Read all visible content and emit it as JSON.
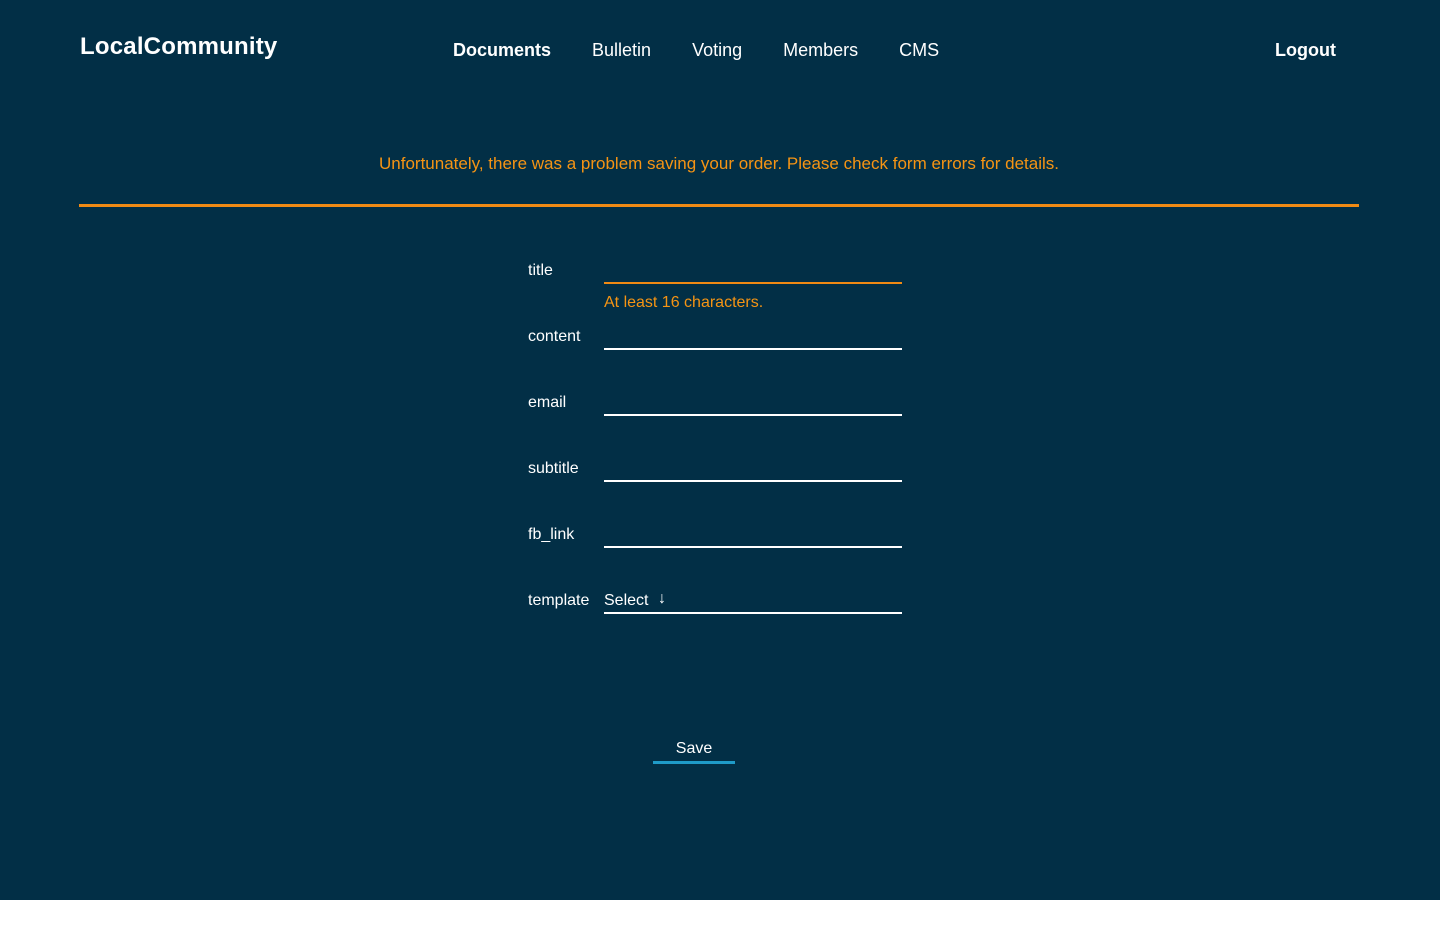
{
  "header": {
    "brand": "LocalCommunity",
    "nav": [
      {
        "label": "Documents",
        "active": true
      },
      {
        "label": "Bulletin",
        "active": false
      },
      {
        "label": "Voting",
        "active": false
      },
      {
        "label": "Members",
        "active": false
      },
      {
        "label": "CMS",
        "active": false
      }
    ],
    "logout_label": "Logout"
  },
  "alert": {
    "message": "Unfortunately, there was a problem saving your order. Please check form errors for details."
  },
  "form": {
    "fields": [
      {
        "label": "title",
        "value": "",
        "error": "At least 16 characters."
      },
      {
        "label": "content",
        "value": ""
      },
      {
        "label": "email",
        "value": ""
      },
      {
        "label": "subtitle",
        "value": ""
      },
      {
        "label": "fb_link",
        "value": ""
      },
      {
        "label": "template",
        "selected": "Select",
        "arrow": "↓"
      }
    ],
    "save_label": "Save"
  },
  "colors": {
    "background": "#022f46",
    "accent_error": "#f59414",
    "button_underline": "#1f9bc8",
    "text": "#ffffff"
  }
}
